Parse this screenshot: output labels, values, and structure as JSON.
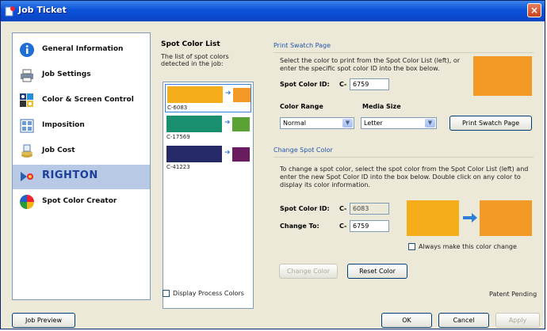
{
  "window": {
    "title": "Job Ticket",
    "close_label": "×"
  },
  "nav": {
    "items": [
      {
        "label": "General Information",
        "icon": "info-icon"
      },
      {
        "label": "Job Settings",
        "icon": "printer-icon"
      },
      {
        "label": "Color & Screen Control",
        "icon": "color-screen-icon"
      },
      {
        "label": "Imposition",
        "icon": "imposition-icon"
      },
      {
        "label": "Job Cost",
        "icon": "job-cost-icon"
      },
      {
        "label": "RIGHTON",
        "icon": "righton-icon",
        "selected": true
      },
      {
        "label": "Spot Color Creator",
        "icon": "color-wheel-icon"
      }
    ]
  },
  "spot_list": {
    "title": "Spot Color List",
    "description": "The list of spot colors detected in the job:",
    "items": [
      {
        "label": "C-6083",
        "from": "#f6ad1a",
        "to": "#f29a25",
        "selected": true
      },
      {
        "label": "C-17569",
        "from": "#1a8f70",
        "to": "#5aa233"
      },
      {
        "label": "C-41223",
        "from": "#262a67",
        "to": "#6b1c61"
      }
    ],
    "display_process_label": "Display Process Colors"
  },
  "print_swatch": {
    "group_title": "Print Swatch Page",
    "instructions": "Select the color to print from the Spot Color List (left), or enter the specific spot color ID into the box below.",
    "spot_id_label": "Spot Color ID:",
    "prefix": "C-",
    "spot_id_value": "6759",
    "preview_color": "#f29a25",
    "color_range_label": "Color Range",
    "color_range_value": "Normal",
    "media_size_label": "Media Size",
    "media_size_value": "Letter",
    "print_button": "Print Swatch Page"
  },
  "change_spot": {
    "group_title": "Change Spot Color",
    "instructions": "To change a spot color, select the spot color from the Spot Color List (left) and enter the new Spot Color ID into the box below. Double click on any color to display its color information.",
    "spot_id_label": "Spot Color ID:",
    "prefix": "C-",
    "spot_id_value": "6083",
    "change_to_label": "Change To:",
    "change_to_value": "6759",
    "from_color": "#f6ad1a",
    "to_color": "#f29a25",
    "always_label": "Always make this color change",
    "change_button": "Change Color",
    "reset_button": "Reset Color"
  },
  "footer": {
    "patent": "Patent Pending",
    "job_preview": "Job Preview",
    "ok": "OK",
    "cancel": "Cancel",
    "apply": "Apply"
  }
}
